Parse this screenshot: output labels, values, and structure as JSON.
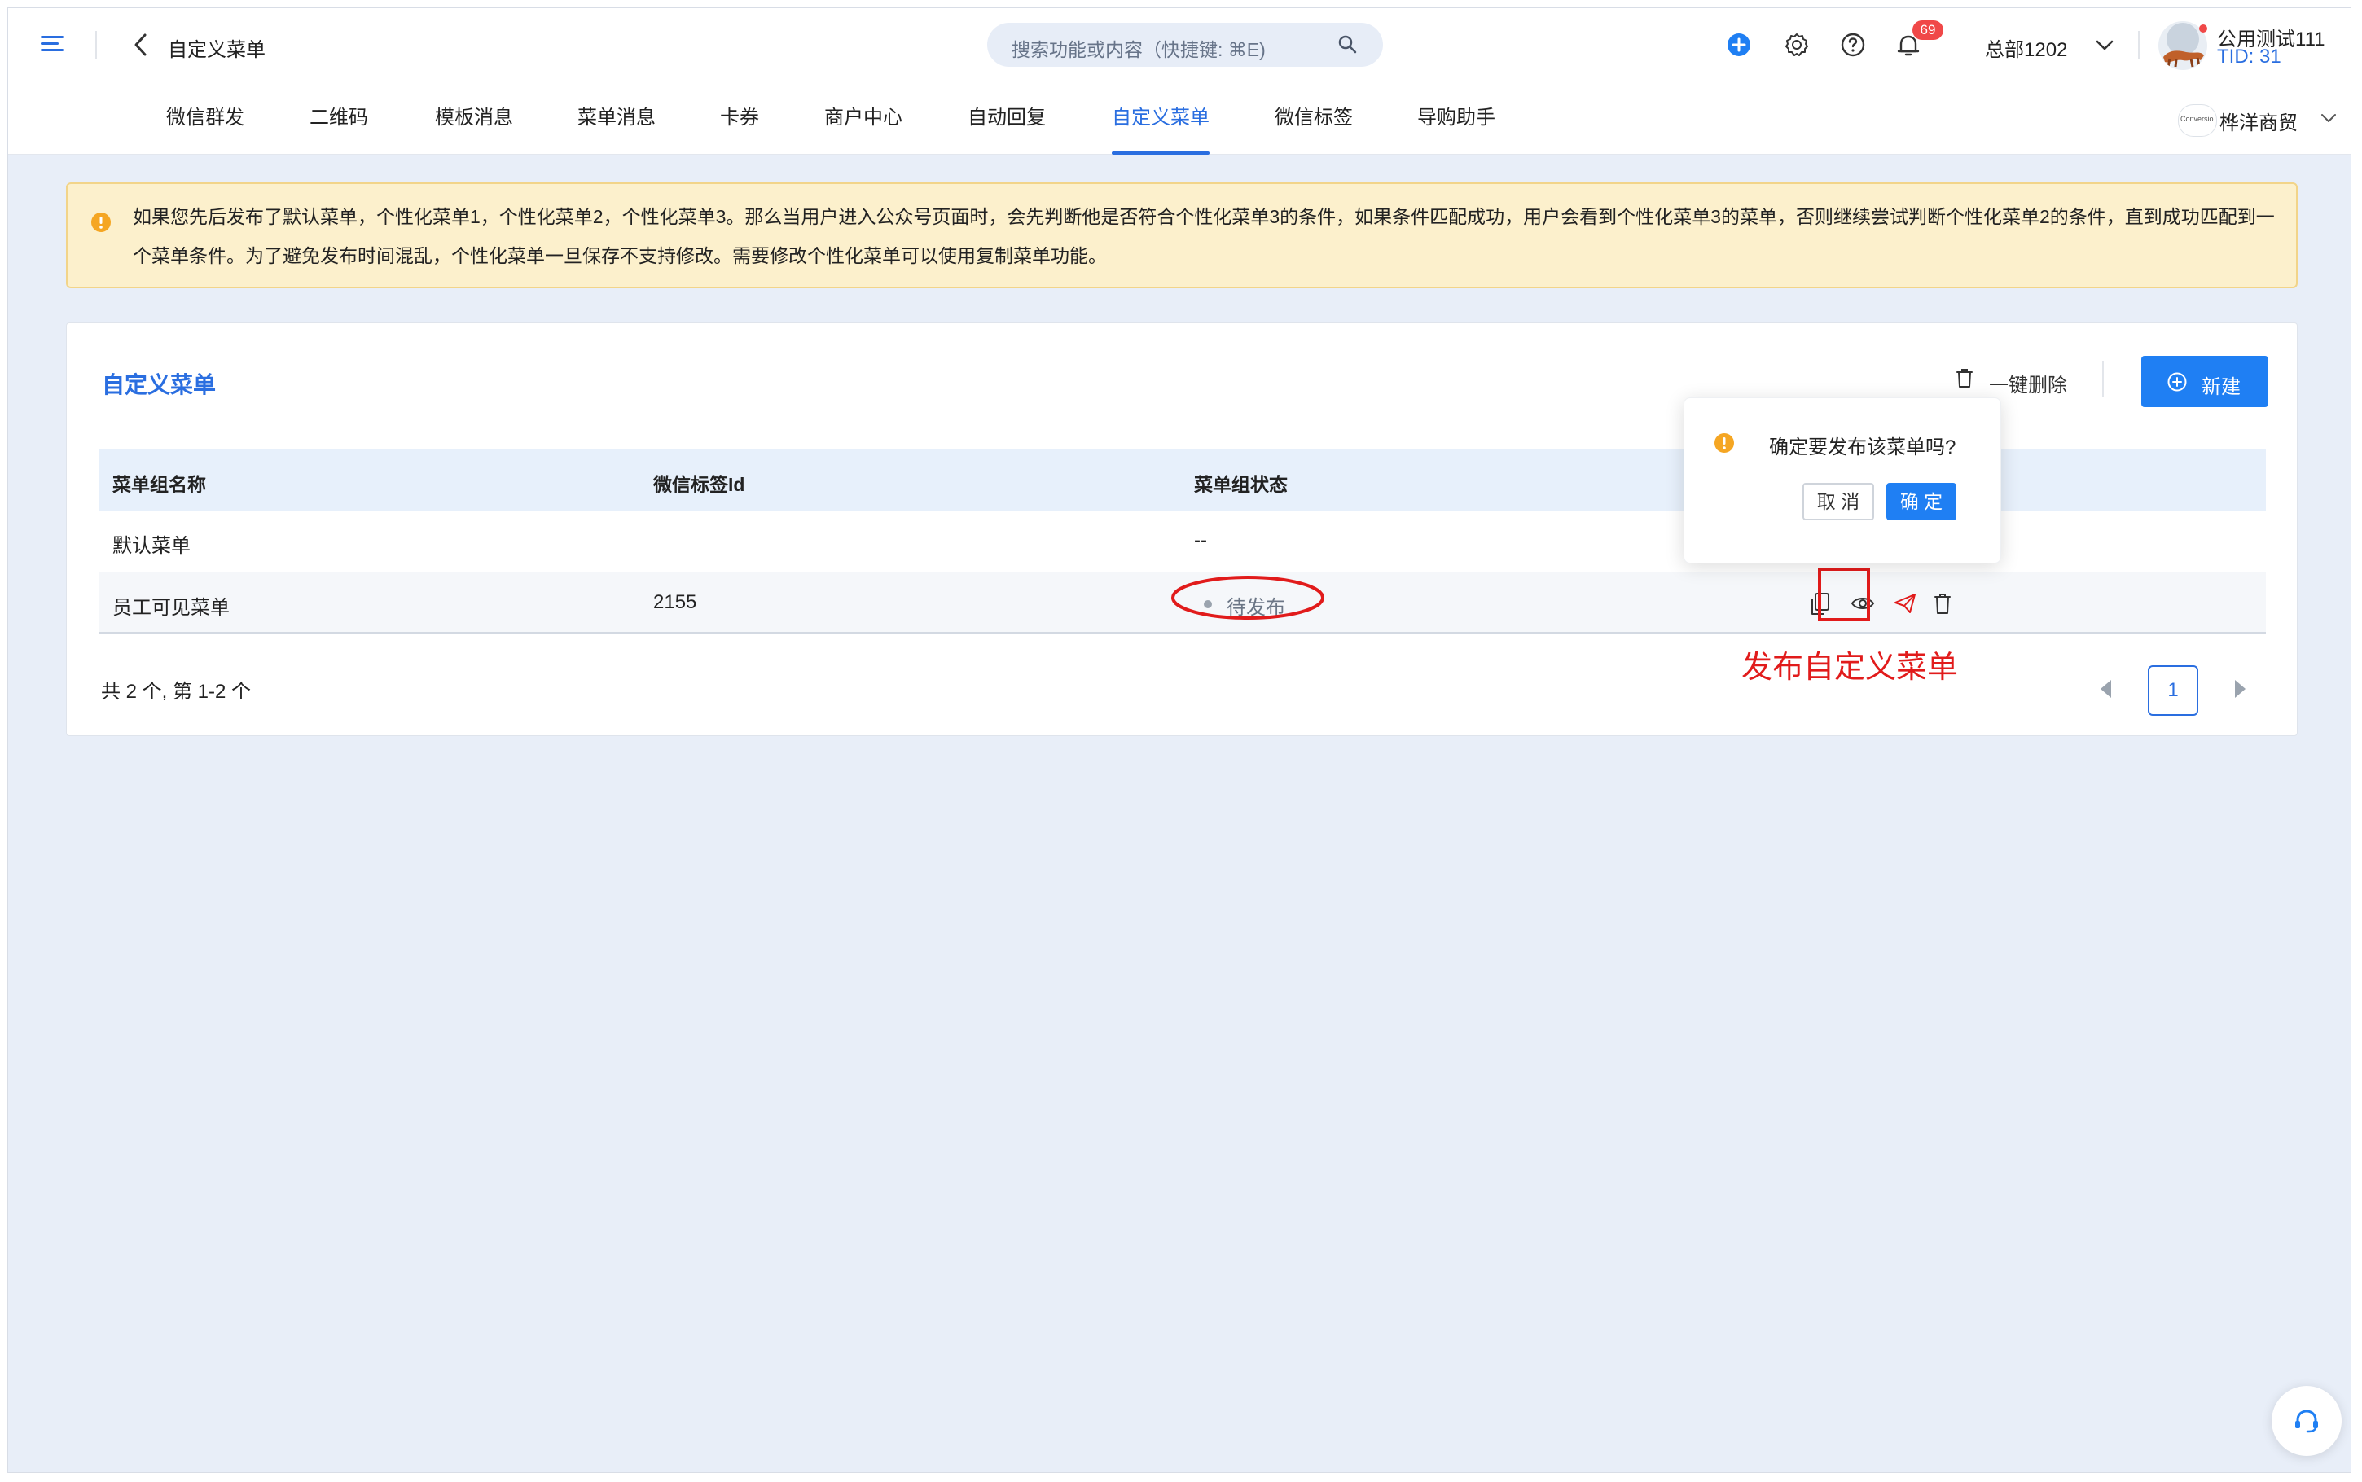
{
  "header": {
    "page_title": "自定义菜单",
    "search_placeholder": "搜索功能或内容（快捷键: ⌘E)",
    "notification_count": "69",
    "org_name": "总部1202",
    "account_name": "公用测试111",
    "tenant_id": "TID: 31"
  },
  "nav": {
    "tabs": [
      {
        "label": "微信群发"
      },
      {
        "label": "二维码"
      },
      {
        "label": "模板消息"
      },
      {
        "label": "菜单消息"
      },
      {
        "label": "卡券"
      },
      {
        "label": "商户中心"
      },
      {
        "label": "自动回复"
      },
      {
        "label": "自定义菜单"
      },
      {
        "label": "微信标签"
      },
      {
        "label": "导购助手"
      }
    ],
    "active_tab": "自定义菜单",
    "account_selector": "桦洋商贸",
    "account_logo_text": "Conversio"
  },
  "notice": {
    "text": "如果您先后发布了默认菜单，个性化菜单1，个性化菜单2，个性化菜单3。那么当用户进入公众号页面时，会先判断他是否符合个性化菜单3的条件，如果条件匹配成功，用户会看到个性化菜单3的菜单，否则继续尝试判断个性化菜单2的条件，直到成功匹配到一个菜单条件。为了避免发布时间混乱，个性化菜单一旦保存不支持修改。需要修改个性化菜单可以使用复制菜单功能。"
  },
  "panel": {
    "title": "自定义菜单",
    "delete_all_label": "一键删除",
    "new_label": "新建",
    "columns": [
      "菜单组名称",
      "微信标签Id",
      "菜单组状态"
    ],
    "rows": [
      {
        "name": "默认菜单",
        "tag_id": "",
        "status": "--"
      },
      {
        "name": "员工可见菜单",
        "tag_id": "2155",
        "status": "待发布"
      }
    ],
    "summary": "共 2 个, 第 1-2 个",
    "current_page": "1"
  },
  "confirm": {
    "message": "确定要发布该菜单吗?",
    "cancel_label": "取 消",
    "ok_label": "确 定"
  },
  "annotation": {
    "label": "发布自定义菜单",
    "color": "#e11b1b"
  },
  "colors": {
    "primary": "#2a6ee0",
    "button": "#1f7ff3",
    "warning": "#f5a623",
    "badge": "#f04848"
  }
}
